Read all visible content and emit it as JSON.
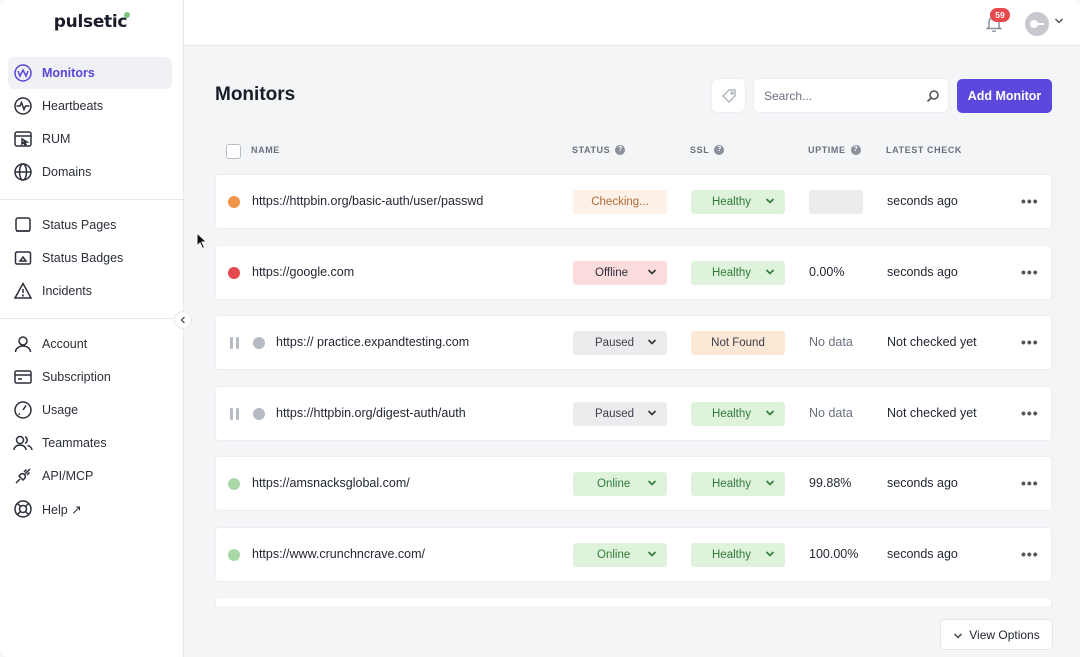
{
  "brand": {
    "name": "pulsetic",
    "dot_color": "#7bc47f"
  },
  "sidebar": {
    "groups": [
      [
        {
          "label": "Monitors",
          "icon": "monitor-wave-icon",
          "active": true
        },
        {
          "label": "Heartbeats",
          "icon": "heartbeat-icon"
        },
        {
          "label": "RUM",
          "icon": "rum-browser-icon"
        },
        {
          "label": "Domains",
          "icon": "globe-icon"
        }
      ],
      [
        {
          "label": "Status Pages",
          "icon": "status-page-icon"
        },
        {
          "label": "Status Badges",
          "icon": "badge-icon"
        },
        {
          "label": "Incidents",
          "icon": "warning-triangle-icon"
        }
      ],
      [
        {
          "label": "Account",
          "icon": "user-icon"
        },
        {
          "label": "Subscription",
          "icon": "card-icon"
        },
        {
          "label": "Usage",
          "icon": "gauge-icon"
        },
        {
          "label": "Teammates",
          "icon": "users-icon"
        },
        {
          "label": "API/MCP",
          "icon": "plug-icon"
        },
        {
          "label": "Help ↗",
          "icon": "lifebuoy-icon"
        }
      ]
    ]
  },
  "topbar": {
    "notification_count": "59"
  },
  "main": {
    "title": "Monitors",
    "search_placeholder": "Search...",
    "add_button": "Add Monitor",
    "view_options": "View Options",
    "columns": {
      "name": "NAME",
      "status": "STATUS",
      "ssl": "SSL",
      "uptime": "UPTIME",
      "latest": "LATEST CHECK"
    }
  },
  "colors": {
    "accent": "#5b48dc",
    "checking_dot": "#f0954a",
    "offline_dot": "#e5484d",
    "paused_dot": "#b7bbc4",
    "online_dot": "#a8d8a8"
  },
  "monitors": [
    {
      "url": "https://httpbin.org/basic-auth/user/passwd",
      "state": "checking",
      "status": "Checking...",
      "ssl": "Healthy",
      "ssl_state": "healthy",
      "uptime": "",
      "latest": "seconds ago"
    },
    {
      "url": "https://google.com",
      "state": "offline",
      "status": "Offline",
      "ssl": "Healthy",
      "ssl_state": "healthy",
      "uptime": "0.00%",
      "latest": "seconds ago"
    },
    {
      "url": "https:// practice.expandtesting.com",
      "state": "paused",
      "status": "Paused",
      "ssl": "Not Found",
      "ssl_state": "notfound",
      "uptime": "No data",
      "latest": "Not checked yet"
    },
    {
      "url": "https://httpbin.org/digest-auth/auth",
      "state": "paused",
      "status": "Paused",
      "ssl": "Healthy",
      "ssl_state": "healthy",
      "uptime": "No data",
      "latest": "Not checked yet"
    },
    {
      "url": "https://amsnacksglobal.com/",
      "state": "online",
      "status": "Online",
      "ssl": "Healthy",
      "ssl_state": "healthy",
      "uptime": "99.88%",
      "latest": "seconds ago"
    },
    {
      "url": "https://www.crunchncrave.com/",
      "state": "online",
      "status": "Online",
      "ssl": "Healthy",
      "ssl_state": "healthy",
      "uptime": "100.00%",
      "latest": "seconds ago"
    }
  ]
}
